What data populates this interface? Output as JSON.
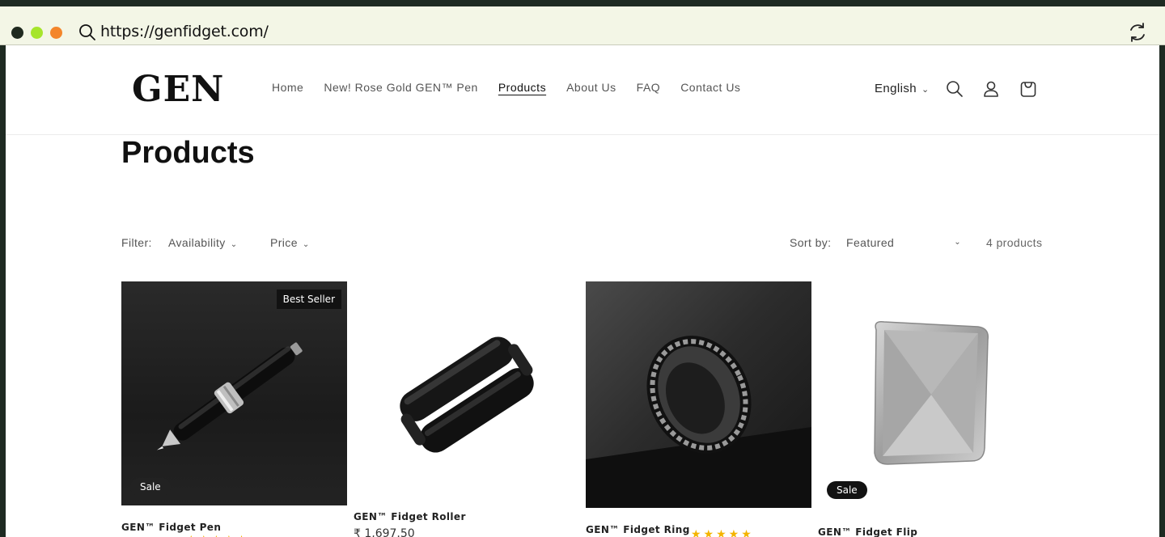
{
  "browser": {
    "url": "https://genfidget.com/"
  },
  "header": {
    "logo": "GEN",
    "nav": [
      "Home",
      "New! Rose Gold GEN™ Pen",
      "Products",
      "About Us",
      "FAQ",
      "Contact Us"
    ],
    "active_nav": "Products",
    "language": "English"
  },
  "page": {
    "title": "Products"
  },
  "filters": {
    "label": "Filter:",
    "availability": "Availability",
    "price": "Price",
    "sort_label": "Sort by:",
    "sort_value": "Featured",
    "count": "4 products"
  },
  "products": [
    {
      "name": "GEN™ Fidget Pen",
      "badge_top": "Best Seller",
      "badge_bottom": "Sale",
      "rating": "★★★★★"
    },
    {
      "name": "GEN™ Fidget Roller",
      "price": "₹ 1,697.50"
    },
    {
      "name": "GEN™ Fidget Ring",
      "rating": "★★★★★"
    },
    {
      "name": "GEN™ Fidget Flip",
      "badge_bottom": "Sale"
    }
  ],
  "colors": {
    "frame": "#1e2a22",
    "address_bar": "#f3f6e6",
    "badge": "#121212",
    "star": "#f4b400"
  },
  "icons": [
    "search-icon",
    "reload-icon",
    "chevron-down-icon",
    "account-icon",
    "cart-icon"
  ]
}
